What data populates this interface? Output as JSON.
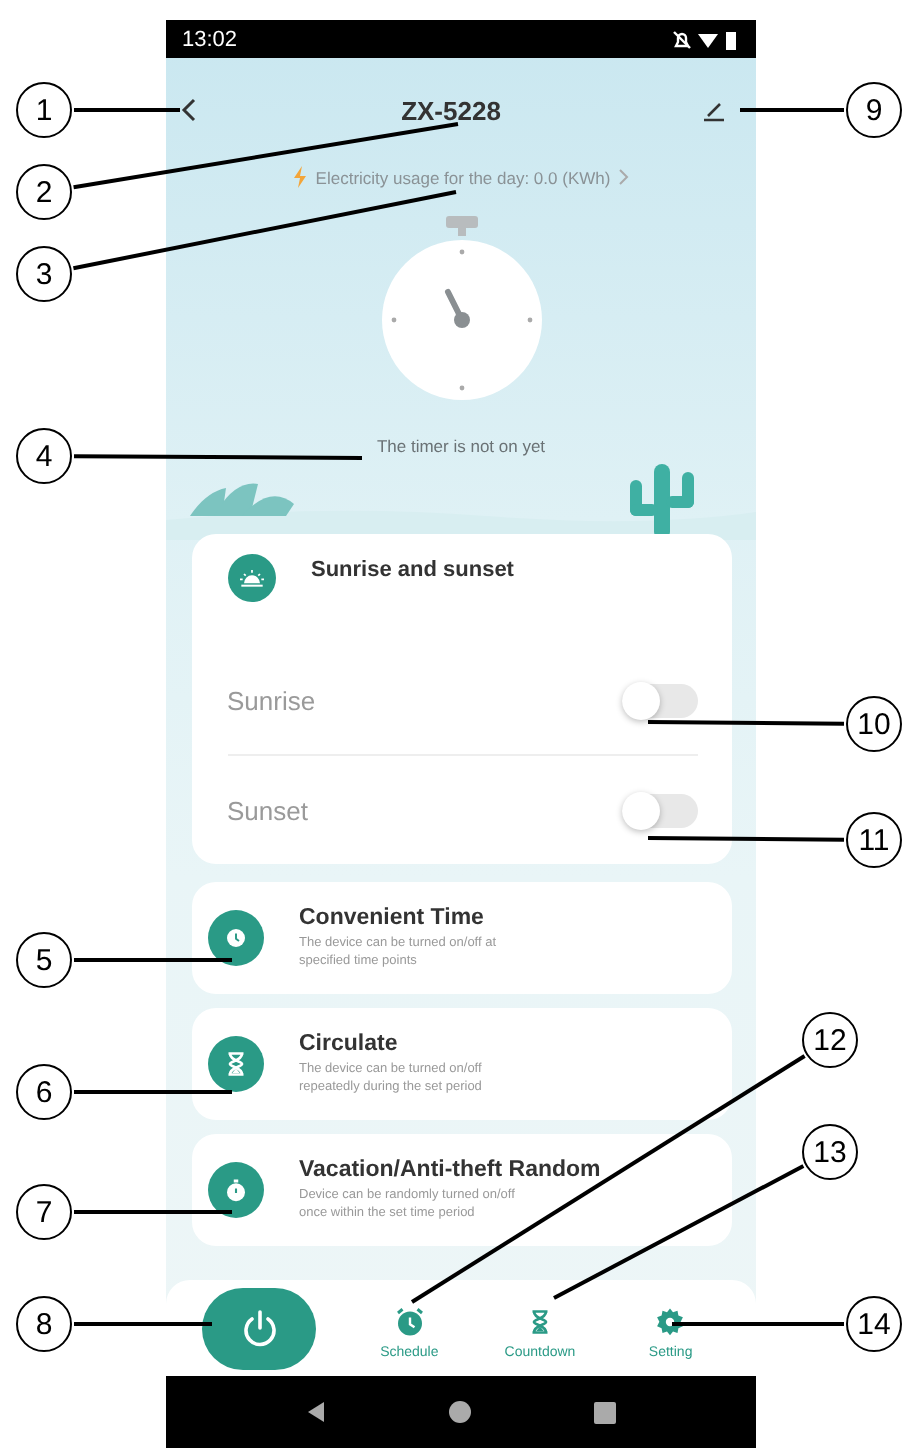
{
  "status_bar": {
    "time": "13:02"
  },
  "header": {
    "title": "ZX-5228",
    "usage": "Electricity usage for the day: 0.0 (KWh)"
  },
  "timer_status": "The timer is not on yet",
  "sun_card": {
    "title": "Sunrise and sunset",
    "toggles": [
      {
        "label": "Sunrise",
        "on": false
      },
      {
        "label": "Sunset",
        "on": false
      }
    ]
  },
  "modes": [
    {
      "kind": "clock",
      "title": "Convenient Time",
      "description": "The device can be turned on/off at specified time points"
    },
    {
      "kind": "hourglass",
      "title": "Circulate",
      "description": "The device can be turned on/off repeatedly during the set period"
    },
    {
      "kind": "stopwatch",
      "title": "Vacation/Anti-theft Random",
      "description": "Device can be randomly turned on/off once within the set time period"
    }
  ],
  "bottom_bar": {
    "tabs": [
      {
        "kind": "alarm",
        "label": "Schedule"
      },
      {
        "kind": "hourglass",
        "label": "Countdown"
      },
      {
        "kind": "gear",
        "label": "Setting"
      }
    ]
  },
  "callouts": [
    "1",
    "2",
    "3",
    "4",
    "5",
    "6",
    "7",
    "8",
    "9",
    "10",
    "11",
    "12",
    "13",
    "14"
  ]
}
